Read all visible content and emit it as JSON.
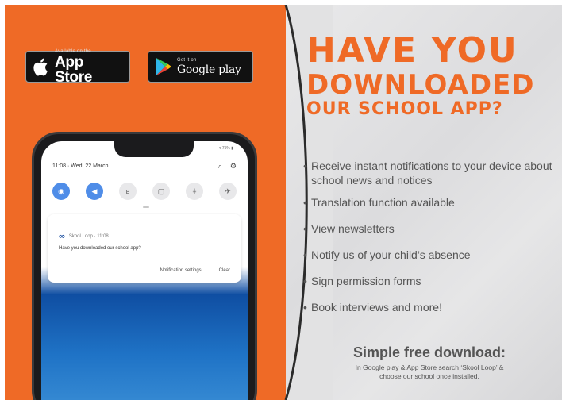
{
  "badges": {
    "appstore": {
      "small": "Available on the",
      "big": "App Store"
    },
    "google": {
      "small": "Get it on",
      "big": "Google play"
    }
  },
  "phone": {
    "status_time": "11:08 · Wed, 22 March",
    "status_right": "▾ 75% ▮",
    "notification": {
      "app": "Skool Loop · 11:08",
      "logo": "∞",
      "message": "Have you downloaded our school app?",
      "action_settings": "Notification settings",
      "action_clear": "Clear"
    }
  },
  "headline": {
    "line1": "HAVE YOU",
    "line2": "DOWNLOADED",
    "line3": "OUR SCHOOL APP?"
  },
  "features": [
    "Receive instant notifications to your device about school news and notices",
    "Translation function available",
    "View newsletters",
    "Notify us of your child’s absence",
    "Sign permission forms",
    "Book interviews and more!"
  ],
  "cta": {
    "title": "Simple free download:",
    "line1": "In Google play & App Store search ‘Skool Loop’ &",
    "line2": "choose our school once installed."
  },
  "colors": {
    "orange": "#ef6a26",
    "grey": "#e2e2e3",
    "phone": "#1b1b1d",
    "toggle_blue": "#4f8de8"
  }
}
